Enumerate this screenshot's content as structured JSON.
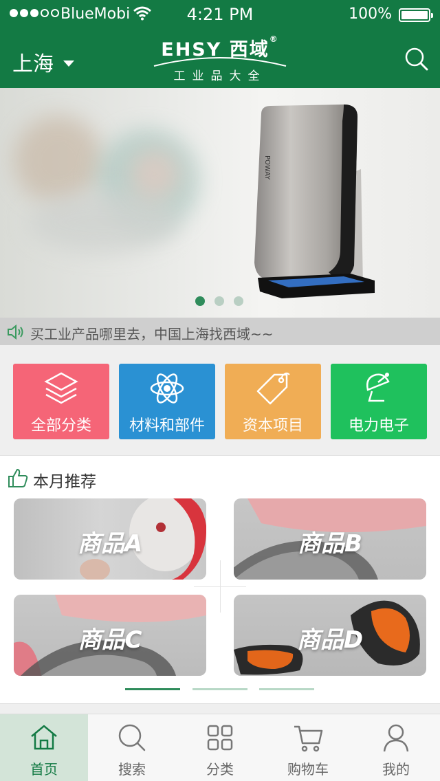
{
  "status_bar": {
    "carrier": "BlueMobi",
    "time": "4:21 PM",
    "battery": "100%"
  },
  "header": {
    "city": "上海",
    "logo_brand": "EHSY",
    "logo_cn": "西域",
    "logo_mark": "®",
    "logo_tagline": "工业品大全"
  },
  "banner": {
    "product_text": "POWAY",
    "slide_count": 3,
    "active_slide": 1
  },
  "notice": {
    "text": "买工业产品哪里去，中国上海找西域~~"
  },
  "categories": [
    {
      "label": "全部分类",
      "color": "#f56577",
      "icon": "layers-icon"
    },
    {
      "label": "材料和部件",
      "color": "#2a91d3",
      "icon": "atom-icon"
    },
    {
      "label": "资本项目",
      "color": "#f0ad55",
      "icon": "tag-icon"
    },
    {
      "label": "电力电子",
      "color": "#1fc15d",
      "icon": "satellite-dish-icon"
    }
  ],
  "recommend": {
    "title": "本月推荐",
    "items": [
      {
        "name": "商品A"
      },
      {
        "name": "商品B"
      },
      {
        "name": "商品C"
      },
      {
        "name": "商品D"
      }
    ],
    "page_count": 3,
    "active_page": 1
  },
  "tabs": [
    {
      "label": "首页",
      "icon": "home-icon",
      "active": true
    },
    {
      "label": "搜索",
      "icon": "search-icon",
      "active": false
    },
    {
      "label": "分类",
      "icon": "grid-icon",
      "active": false
    },
    {
      "label": "购物车",
      "icon": "cart-icon",
      "active": false
    },
    {
      "label": "我的",
      "icon": "user-icon",
      "active": false
    }
  ],
  "colors": {
    "brand_green": "#137a44",
    "tab_active_bg": "#d3e4d8"
  }
}
